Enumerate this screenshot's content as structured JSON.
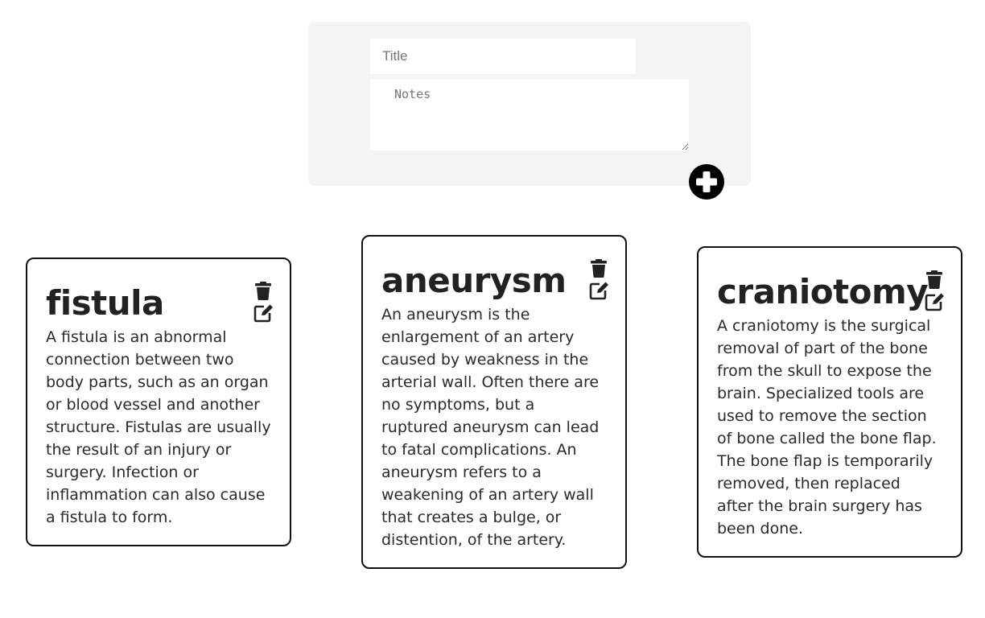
{
  "form": {
    "title_placeholder": "Title",
    "notes_placeholder": "Notes",
    "add_icon": "plus-circle-icon"
  },
  "notes": [
    {
      "title": "fistula",
      "body": "A fistula is an abnormal\nconnection between two\nbody parts, such as an organ\nor blood vessel and another\nstructure. Fistulas are usually\nthe result of an injury or\nsurgery. Infection or\ninflammation can also cause\na fistula to form."
    },
    {
      "title": "aneurysm",
      "body": "An aneurysm is the\nenlargement of an artery\ncaused by weakness in the\narterial wall. Often there are\nno symptoms, but a\nruptured aneurysm can lead\nto fatal complications. An\naneurysm refers to a\nweakening of an artery wall\nthat creates a bulge, or\ndistention, of the artery."
    },
    {
      "title": "craniotomy",
      "body": "A craniotomy is the surgical\nremoval of part of the bone\nfrom the skull to expose the\nbrain. Specialized tools are\nused to remove the section\nof bone called the bone flap.\nThe bone flap is temporarily\nremoved, then replaced\nafter the brain surgery has\nbeen done."
    }
  ],
  "icons": {
    "delete": "trash-icon",
    "edit": "edit-icon"
  },
  "colors": {
    "panel_bg": "#f4f4f4",
    "card_border": "#111111",
    "icon": "#222222",
    "add_button": "#000000"
  }
}
